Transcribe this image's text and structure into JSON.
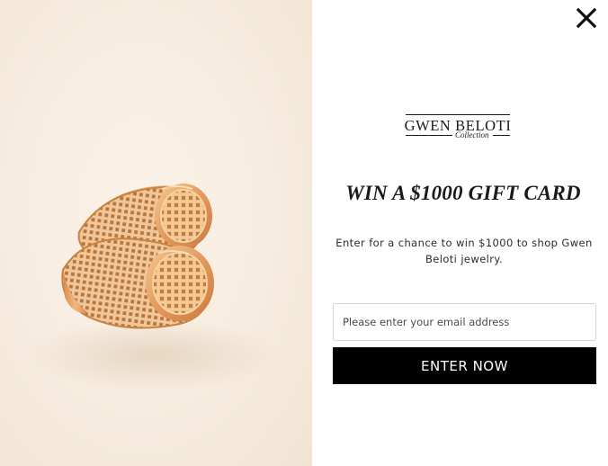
{
  "image": {
    "description_icon": "gold-lattice-rings-image"
  },
  "close": {
    "icon": "close-icon"
  },
  "logo": {
    "brand": "GWEN BELOTI",
    "tagline": "Collection"
  },
  "headline": "WIN A $1000 GIFT CARD",
  "subtext": "Enter for a chance to win $1000 to shop Gwen Beloti jewelry.",
  "email": {
    "placeholder": "Please enter your email address",
    "value": ""
  },
  "cta": {
    "label": "ENTER NOW"
  },
  "colors": {
    "button_bg": "#000000",
    "button_text": "#ffffff",
    "panel_bg": "#f6ecdf",
    "gold": "#e3a36a"
  }
}
